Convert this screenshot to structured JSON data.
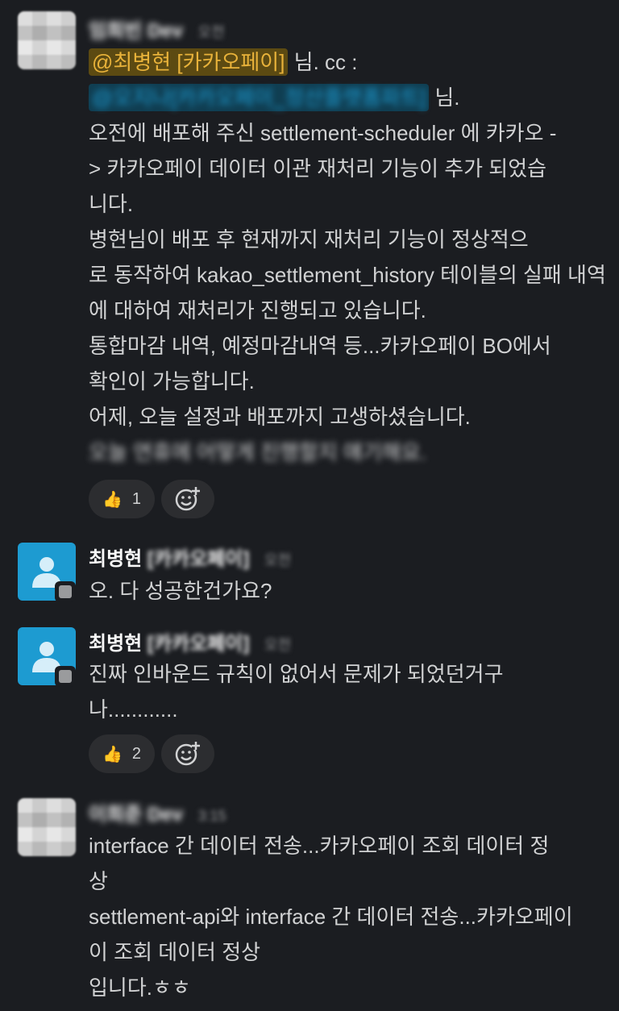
{
  "messages": [
    {
      "author": "임희빈 Dev",
      "time": "오전",
      "mention1": "@최병현 [카카오페이]",
      "mention1_suffix": " 님. cc :",
      "mention2": "@오지나[카카오페이_정산플랫폼파트]",
      "mention2_suffix": " 님.",
      "lines": [
        "오전에 배포해 주신 settlement-scheduler 에 카카오 -",
        "> 카카오페이 데이터 이관 재처리 기능이 추가 되었습",
        "니다.",
        "병현님이 배포 후 현재까지 재처리 기능이 정상적으",
        "로 동작하여 kakao_settlement_history 테이블의 실패 내역",
        "에 대하여 재처리가 진행되고 있습니다.",
        "통합마감 내역, 예정마감내역 등...카카오페이 BO에서",
        "확인이 가능합니다.",
        "어제, 오늘 설정과 배포까지 고생하셨습니다.",
        "오늘 연휴에 어떻게 진행할지 얘기해요."
      ],
      "reaction": {
        "emoji": "👍",
        "count": "1"
      }
    },
    {
      "author": "최병현",
      "tag": "[카카오페이]",
      "time": "오전",
      "lines": [
        "오. 다 성공한건가요?"
      ]
    },
    {
      "author": "최병현",
      "tag": "[카카오페이]",
      "time": "오전",
      "lines": [
        "진짜 인바운드 규칙이 없어서 문제가 되었던거구",
        "나............"
      ],
      "reaction": {
        "emoji": "👍",
        "count": "2"
      }
    },
    {
      "author": "이희준 Dev",
      "time": "3:15",
      "lines": [
        "interface 간 데이터 전송...카카오페이 조회 데이터 정",
        "상",
        "settlement-api와 interface 간 데이터 전송...카카오페이",
        "이 조회 데이터 정상",
        "입니다.ㅎㅎ"
      ]
    }
  ]
}
